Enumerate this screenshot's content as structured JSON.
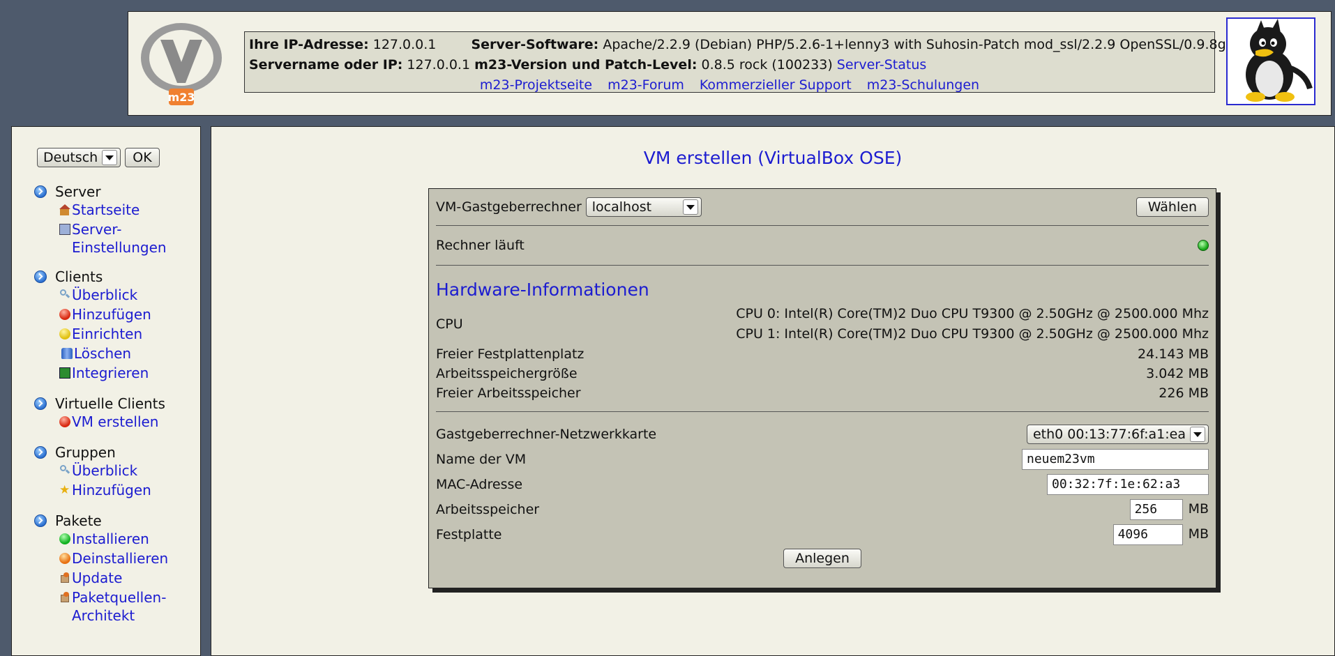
{
  "header": {
    "ip_label": "Ihre IP-Adresse:",
    "ip_value": "127.0.0.1",
    "software_label": "Server-Software:",
    "software_value": "Apache/2.2.9 (Debian) PHP/5.2.6-1+lenny3 with Suhosin-Patch mod_ssl/2.2.9 OpenSSL/0.9.8g",
    "servername_label": "Servername oder IP:",
    "servername_value": "127.0.0.1",
    "version_label": "m23-Version und Patch-Level:",
    "version_value": "0.8.5 rock (100233)",
    "server_status_link": "Server-Status",
    "links": [
      "m23-Projektseite",
      "m23-Forum",
      "Kommerzieller Support",
      "m23-Schulungen"
    ],
    "logo_text": "m23"
  },
  "sidebar": {
    "language_selected": "Deutsch",
    "ok_label": "OK",
    "sections": [
      {
        "title": "Server",
        "items": [
          {
            "label": "Startseite",
            "icon": "home-icon"
          },
          {
            "label": "Server-Einstellungen",
            "icon": "monitor-icon"
          }
        ]
      },
      {
        "title": "Clients",
        "items": [
          {
            "label": "Überblick",
            "icon": "magnifier-icon"
          },
          {
            "label": "Hinzufügen",
            "icon": "red-ball-icon"
          },
          {
            "label": "Einrichten",
            "icon": "yellow-ball-icon"
          },
          {
            "label": "Löschen",
            "icon": "trash-can-icon"
          },
          {
            "label": "Integrieren",
            "icon": "network-icon"
          }
        ]
      },
      {
        "title": "Virtuelle Clients",
        "items": [
          {
            "label": "VM erstellen",
            "icon": "red-ball-icon"
          }
        ]
      },
      {
        "title": "Gruppen",
        "items": [
          {
            "label": "Überblick",
            "icon": "magnifier-icon"
          },
          {
            "label": "Hinzufügen",
            "icon": "star-icon"
          }
        ]
      },
      {
        "title": "Pakete",
        "items": [
          {
            "label": "Installieren",
            "icon": "green-ball-icon"
          },
          {
            "label": "Deinstallieren",
            "icon": "uninstall-icon"
          },
          {
            "label": "Update",
            "icon": "package-icon"
          },
          {
            "label": "Paketquellen-Architekt",
            "icon": "package-icon"
          }
        ]
      }
    ]
  },
  "main": {
    "title": "VM erstellen (VirtualBox OSE)",
    "host_label": "VM-Gastgeberrechner",
    "host_selected": "localhost",
    "choose_label": "Wählen",
    "running_label": "Rechner läuft",
    "hw_title": "Hardware-Informationen",
    "cpu_label": "CPU",
    "cpu_values": [
      "CPU 0: Intel(R) Core(TM)2 Duo CPU T9300 @ 2.50GHz @ 2500.000 Mhz",
      "CPU 1: Intel(R) Core(TM)2 Duo CPU T9300 @ 2.50GHz @ 2500.000 Mhz"
    ],
    "disk_free_label": "Freier Festplattenplatz",
    "disk_free_value": "24.143 MB",
    "mem_size_label": "Arbeitsspeichergröße",
    "mem_size_value": "3.042 MB",
    "mem_free_label": "Freier Arbeitsspeicher",
    "mem_free_value": "226 MB",
    "nic_label": "Gastgeberrechner-Netzwerkkarte",
    "nic_selected": "eth0 00:13:77:6f:a1:ea",
    "vmname_label": "Name der VM",
    "vmname_value": "neuem23vm",
    "mac_label": "MAC-Adresse",
    "mac_value": "00:32:7f:1e:62:a3",
    "ram_label": "Arbeitsspeicher",
    "ram_value": "256",
    "ram_unit": "MB",
    "hdd_label": "Festplatte",
    "hdd_value": "4096",
    "hdd_unit": "MB",
    "create_label": "Anlegen"
  },
  "colors": {
    "background": "#4e5a6c",
    "panel": "#f2f1e6",
    "box": "#c4c3b5",
    "link": "#1c1cd0"
  }
}
